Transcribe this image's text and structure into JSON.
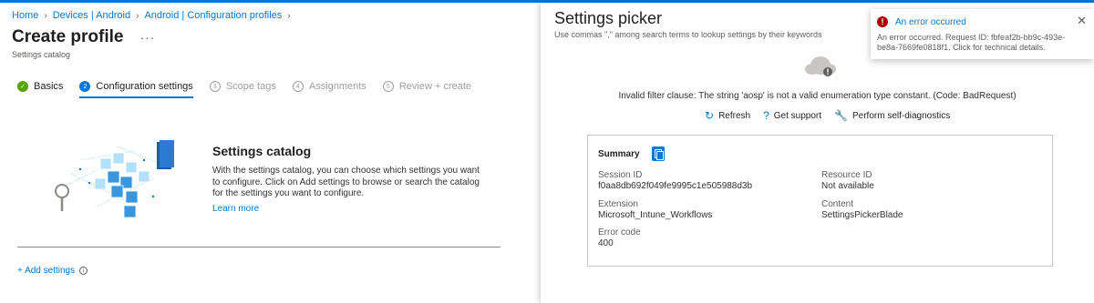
{
  "breadcrumb": [
    "Home",
    "Devices | Android",
    "Android | Configuration profiles"
  ],
  "page": {
    "title": "Create profile",
    "more": "···",
    "subtitle": "Settings catalog"
  },
  "wizard": [
    {
      "num": "✓",
      "label": "Basics",
      "state": "done"
    },
    {
      "num": "2",
      "label": "Configuration settings",
      "state": "active"
    },
    {
      "num": "3",
      "label": "Scope tags",
      "state": "pending"
    },
    {
      "num": "4",
      "label": "Assignments",
      "state": "pending"
    },
    {
      "num": "5",
      "label": "Review + create",
      "state": "pending"
    }
  ],
  "catalog": {
    "heading": "Settings catalog",
    "description": "With the settings catalog, you can choose which settings you want to configure. Click on Add settings to browse or search the catalog for the settings you want to configure.",
    "learn_more": "Learn more"
  },
  "add_settings": {
    "label": "+ Add settings",
    "info": "i"
  },
  "picker": {
    "title": "Settings picker",
    "subtitle": "Use commas \",\" among search terms to lookup settings by their keywords",
    "error_message": "Invalid filter clause: The string 'aosp' is not a valid enumeration type constant. (Code: BadRequest)",
    "actions": [
      {
        "icon": "refresh-icon",
        "glyph": "↻",
        "label": "Refresh"
      },
      {
        "icon": "help-icon",
        "glyph": "?",
        "label": "Get support"
      },
      {
        "icon": "wrench-icon",
        "glyph": "🔧",
        "label": "Perform self-diagnostics"
      }
    ]
  },
  "summary": {
    "title": "Summary",
    "session_id_label": "Session ID",
    "session_id": "f0aa8db692f049fe9995c1e505988d3b",
    "resource_id_label": "Resource ID",
    "resource_id": "Not available",
    "extension_label": "Extension",
    "extension": "Microsoft_Intune_Workflows",
    "content_label": "Content",
    "content": "SettingsPickerBlade",
    "error_code_label": "Error code",
    "error_code": "400"
  },
  "toast": {
    "title": "An error occurred",
    "body": "An error occurred. Request ID: fbfeaf2b-bb9c-493e-be8a-7669fe0818f1. Click for technical details.",
    "close": "✕"
  },
  "colors": {
    "accent": "#0078d4",
    "success": "#57a300",
    "error": "#a80000"
  }
}
